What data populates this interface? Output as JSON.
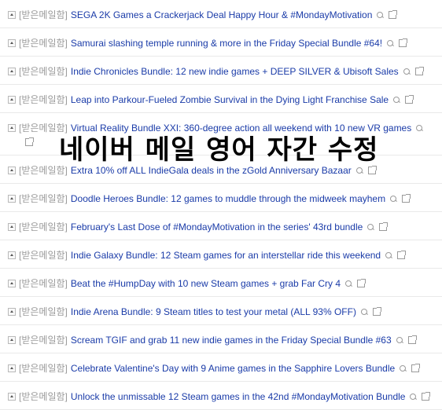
{
  "overlay_title": "네이버 메일 영어 자간 수정",
  "folder_label": "[받은메일함]",
  "rows": [
    {
      "subject": "SEGA 2K Games a Crackerjack Deal Happy Hour & #MondayMotivation"
    },
    {
      "subject": "Samurai slashing temple running & more in the Friday Special Bundle #64!"
    },
    {
      "subject": "Indie Chronicles Bundle: 12 new indie games + DEEP SILVER & Ubisoft Sales"
    },
    {
      "subject": "Leap into Parkour-Fueled Zombie Survival in the Dying Light Franchise Sale"
    },
    {
      "subject": "Virtual Reality Bundle XXI: 360-degree action all weekend with 10 new VR games"
    },
    {
      "subject": "Extra 10% off ALL IndieGala deals in the zGold Anniversary Bazaar"
    },
    {
      "subject": "Doodle Heroes Bundle: 12 games to muddle through the midweek mayhem"
    },
    {
      "subject": "February's Last Dose of #MondayMotivation in the series' 43rd bundle"
    },
    {
      "subject": "Indie Galaxy Bundle: 12 Steam games for an interstellar ride this weekend"
    },
    {
      "subject": "Beat the #HumpDay with 10 new Steam games + grab Far Cry 4"
    },
    {
      "subject": "Indie Arena Bundle: 9 Steam titles to test your metal (ALL 93% OFF)"
    },
    {
      "subject": "Scream TGIF and grab 11 new indie games in the Friday Special Bundle #63"
    },
    {
      "subject": "Celebrate Valentine's Day with 9 Anime games in the Sapphire Lovers Bundle"
    },
    {
      "subject": "Unlock the unmissable 12 Steam games in the 42nd #MondayMotivation Bundle"
    }
  ]
}
